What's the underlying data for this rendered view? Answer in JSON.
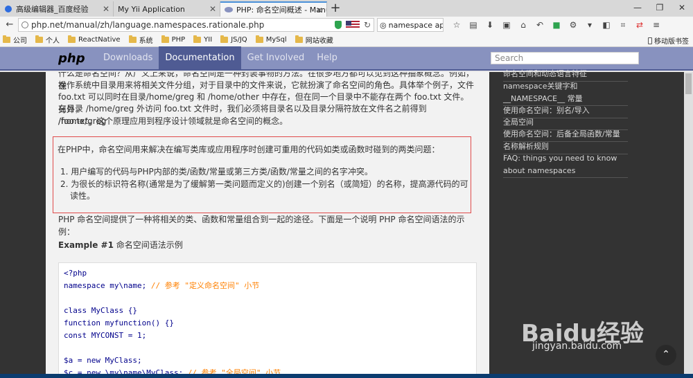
{
  "tabs": [
    {
      "label": "高级编辑器_百度经验",
      "active": false
    },
    {
      "label": "My Yii Application",
      "active": false
    },
    {
      "label": "PHP: 命名空间概述 - Manual",
      "active": true
    }
  ],
  "window": {
    "minimize": "—",
    "maximize": "❐",
    "close": "✕"
  },
  "navbar": {
    "url": "php.net/manual/zh/language.namespaces.rationale.php",
    "search_value": "namespace ap"
  },
  "bookmarks": [
    "公司",
    "个人",
    "ReactNative",
    "系统",
    "PHP",
    "YII",
    "JS/JQ",
    "MySql",
    "网站收藏"
  ],
  "mobile_bookmarks": "移动版书签",
  "php_header": {
    "logo": "php",
    "links": [
      {
        "label": "Downloads",
        "active": false
      },
      {
        "label": "Documentation",
        "active": true
      },
      {
        "label": "Get Involved",
        "active": false
      },
      {
        "label": "Help",
        "active": false
      }
    ],
    "search_placeholder": "Search"
  },
  "content": {
    "top_para_line0": "什么是命名空间？从广义上来说，命名空间是一种封装事物的方法。在很多地方都可以见到这种抽象概念。例如，在",
    "top_para_line1": "操作系统中目录用来将相关文件分组，对于目录中的文件来说，它就扮演了命名空间的角色。具体举个例子，文件",
    "top_para_line2": "foo.txt 可以同时在目录/home/greg 和 /home/other 中存在，但在同一个目录中不能存在两个 foo.txt 文件。另外，",
    "top_para_line3": "在目录 /home/greg 外访问 foo.txt 文件时，我们必须将目录名以及目录分隔符放在文件名之前得到 /home/greg",
    "top_para_line4": "/foo.txt。这个原理应用到程序设计领域就是命名空间的概念。",
    "box_lead": "在PHP中，命名空间用来解决在编写类库或应用程序时创建可重用的代码如类或函数时碰到的两类问题：",
    "box_items": [
      "1. 用户编写的代码与PHP内部的类/函数/常量或第三方类/函数/常量之间的名字冲突。",
      "2. 为很长的标识符名称(通常是为了缓解第一类问题而定义的)创建一个别名（或简短）的名称，提高源代码的可读性。"
    ],
    "para2": "PHP 命名空间提供了一种将相关的类、函数和常量组合到一起的途径。下面是一个说明 PHP 命名空间语法的示例：",
    "example_label": "Example #1",
    "example_title": "命名空间语法示例",
    "code": [
      "<?php",
      "namespace my\\name; // 参考 \"定义命名空间\" 小节",
      "",
      "class MyClass {}",
      "function myfunction() {}",
      "const MYCONST = 1;",
      "",
      "$a = new MyClass;",
      "$c = new \\my\\name\\MyClass; // 参考 \"全局空间\" 小节"
    ]
  },
  "sidebar": [
    "命名空间和动态语言特征",
    "namespace关键字和__NAMESPACE__ 常量",
    "使用命名空间：别名/导入",
    "全局空间",
    "使用命名空间：后备全局函数/常量",
    "名称解析规则",
    "FAQ: things you need to know about namespaces"
  ],
  "watermark": {
    "main": "Baidu经验",
    "sub": "jingyan.baidu.com"
  }
}
